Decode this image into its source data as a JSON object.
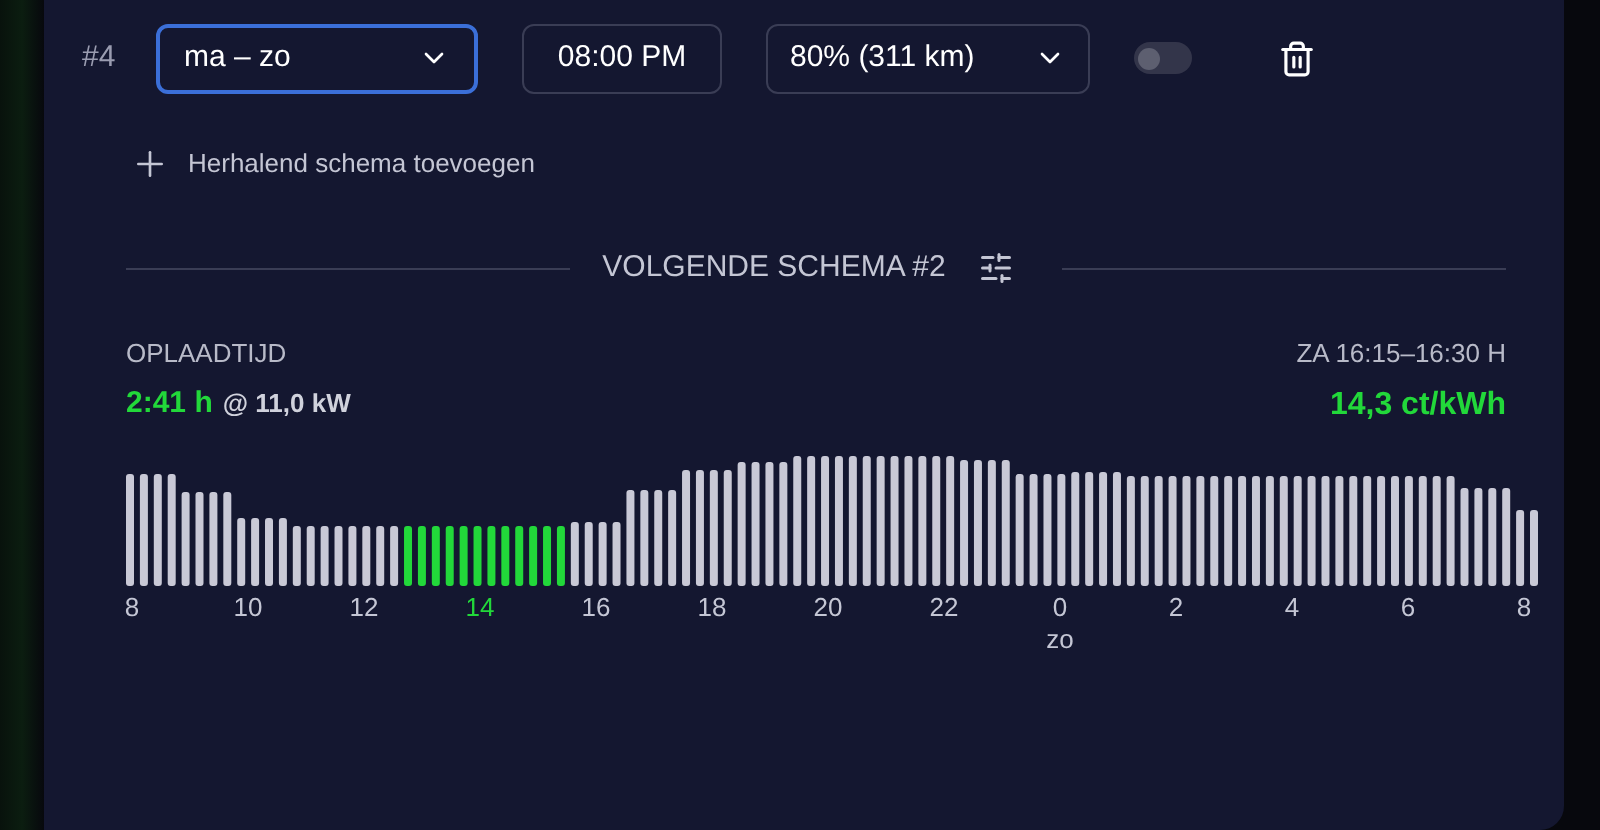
{
  "schedule_row": {
    "number": "#4",
    "days": {
      "value": "ma – zo",
      "focused": true
    },
    "time": "08:00 PM",
    "target": "80% (311 km)",
    "enabled": false
  },
  "add_button": "Herhalend schema toevoegen",
  "section_title": "VOLGENDE SCHEMA #2",
  "summary": {
    "label": "OPLAADTIJD",
    "duration": "2:41 h",
    "power": "@ 11,0 kW",
    "slot": "ZA 16:15–16:30 H",
    "price": "14,3 ct/kWh"
  },
  "chart": {
    "x_labels": [
      {
        "label": "8",
        "selected": false
      },
      {
        "label": "10",
        "selected": false
      },
      {
        "label": "12",
        "selected": false
      },
      {
        "label": "14",
        "selected": true
      },
      {
        "label": "16",
        "selected": false
      },
      {
        "label": "18",
        "selected": false
      },
      {
        "label": "20",
        "selected": false
      },
      {
        "label": "22",
        "selected": false
      },
      {
        "label": "0",
        "selected": false,
        "sub": "zo"
      },
      {
        "label": "2",
        "selected": false
      },
      {
        "label": "4",
        "selected": false
      },
      {
        "label": "6",
        "selected": false
      },
      {
        "label": "8",
        "selected": false
      }
    ]
  }
}
